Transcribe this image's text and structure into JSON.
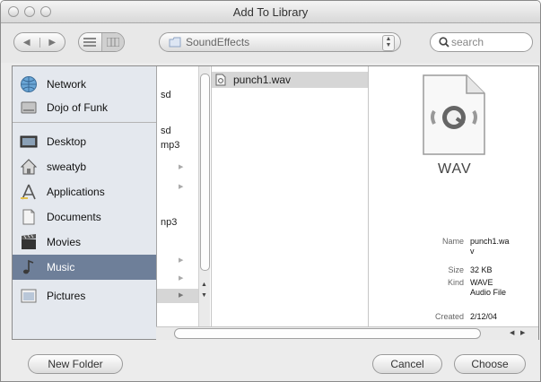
{
  "window": {
    "title": "Add To Library"
  },
  "toolbar": {
    "back_glyph": "◀",
    "forward_glyph": "▶",
    "path": "SoundEffects",
    "path_arrows": "⌃⌄",
    "search_placeholder": "search"
  },
  "sidebar": {
    "devices": [
      {
        "label": "Network",
        "icon": "network-globe-icon"
      },
      {
        "label": "Dojo of Funk",
        "icon": "hard-drive-icon"
      }
    ],
    "places": [
      {
        "label": "Desktop",
        "icon": "desktop-icon"
      },
      {
        "label": "sweatyb",
        "icon": "home-icon"
      },
      {
        "label": "Applications",
        "icon": "applications-icon"
      },
      {
        "label": "Documents",
        "icon": "documents-folder-icon"
      },
      {
        "label": "Movies",
        "icon": "movies-clapper-icon"
      },
      {
        "label": "Music",
        "icon": "music-note-icon",
        "selected": true
      },
      {
        "label": "Pictures",
        "icon": "pictures-icon"
      }
    ]
  },
  "column1": {
    "fragments": [
      "sd",
      "sd",
      "mp3",
      "np3"
    ]
  },
  "column2": {
    "items": [
      {
        "name": "punch1.wav",
        "icon": "wav-file-icon",
        "selected": true
      }
    ]
  },
  "preview": {
    "badge": "WAV",
    "rows": [
      {
        "key": "Name",
        "value": "punch1.wa\nv"
      },
      {
        "key": "Size",
        "value": "32 KB"
      },
      {
        "key": "Kind",
        "value": "WAVE\nAudio File"
      },
      {
        "key": "Created",
        "value": "2/12/04"
      }
    ]
  },
  "buttons": {
    "new_folder": "New Folder",
    "cancel": "Cancel",
    "choose": "Choose"
  },
  "colors": {
    "selection_sidebar": "#6e7f99",
    "selection_row": "#d6d6d6"
  }
}
